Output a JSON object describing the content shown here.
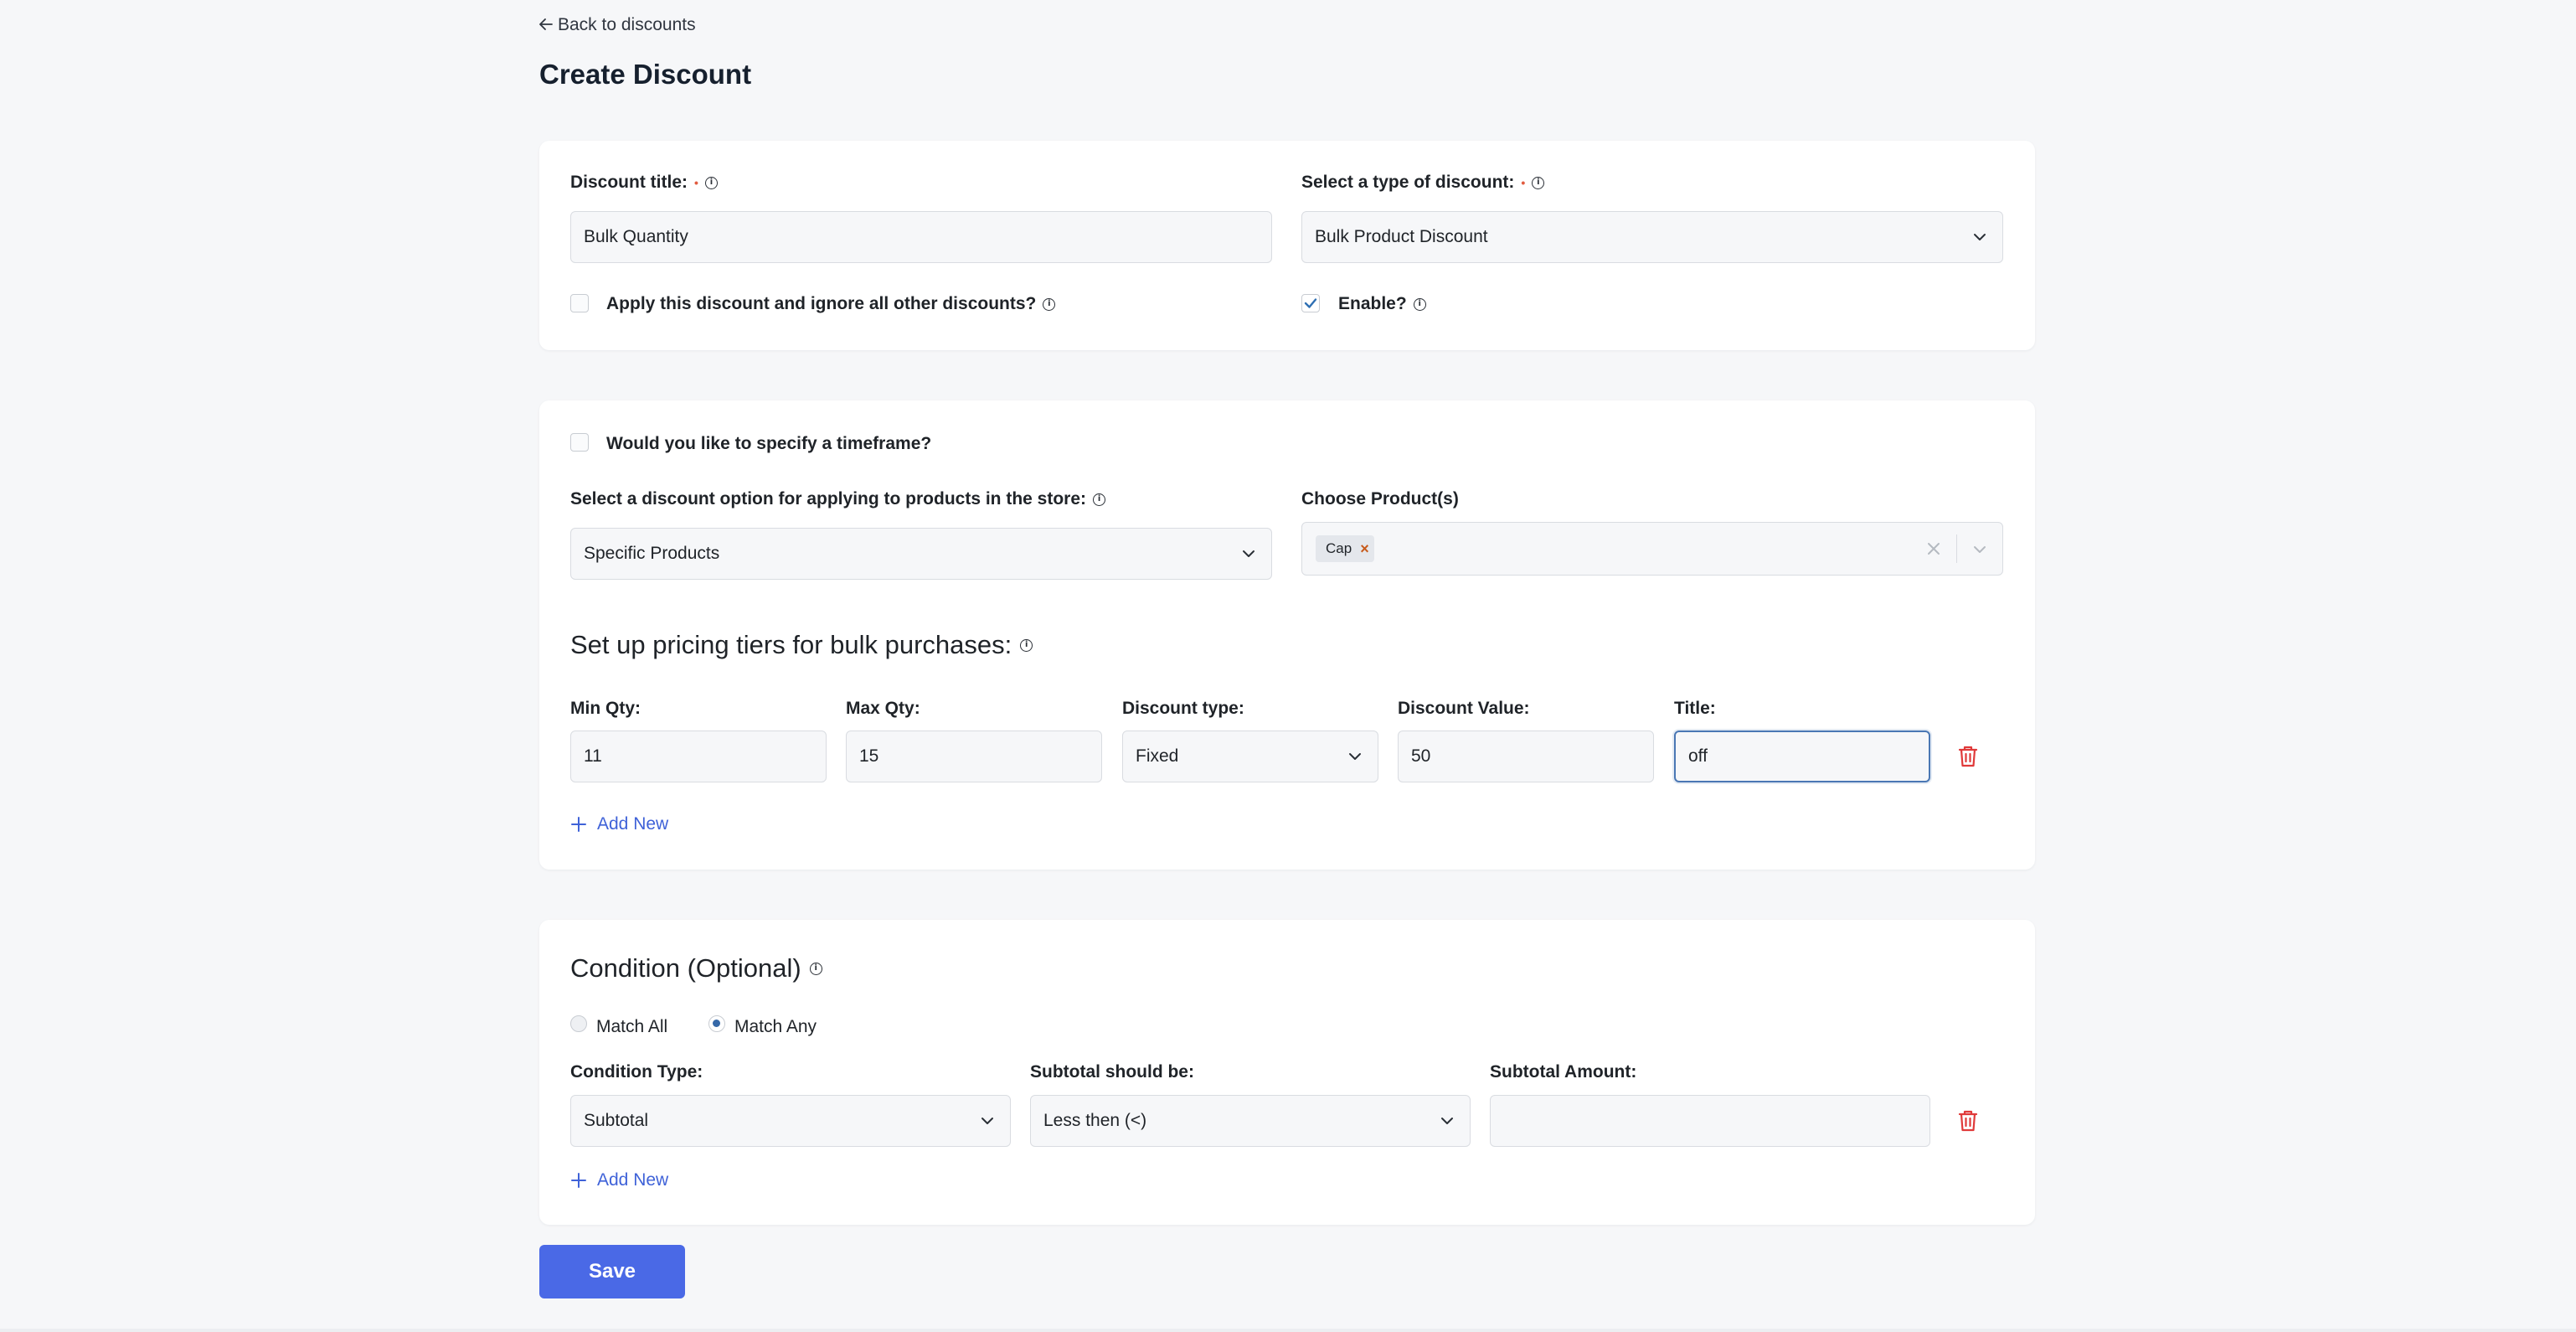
{
  "nav": {
    "back_label": "Back to discounts"
  },
  "page": {
    "title": "Create Discount"
  },
  "general": {
    "discount_title_label": "Discount title:",
    "discount_title_value": "Bulk Quantity",
    "type_label": "Select a type of discount:",
    "type_value": "Bulk Product Discount",
    "exclusive_label": "Apply this discount and ignore all other discounts?",
    "exclusive_checked": false,
    "enable_label": "Enable?",
    "enable_checked": true
  },
  "products": {
    "timeframe_label": "Would you like to specify a timeframe?",
    "timeframe_checked": false,
    "option_label": "Select a discount option for applying to products in the store:",
    "option_value": "Specific Products",
    "choose_label": "Choose Product(s)",
    "chosen_tags": [
      "Cap"
    ]
  },
  "tiers": {
    "title": "Set up pricing tiers for bulk purchases:",
    "headers": {
      "min": "Min Qty:",
      "max": "Max Qty:",
      "type": "Discount type:",
      "value": "Discount Value:",
      "title": "Title:"
    },
    "rows": [
      {
        "min": "11",
        "max": "15",
        "type": "Fixed",
        "value": "50",
        "title": "off"
      }
    ],
    "add_label": "Add New"
  },
  "conditions": {
    "title": "Condition (Optional)",
    "match_all_label": "Match All",
    "match_any_label": "Match Any",
    "selected_match": "Match Any",
    "headers": {
      "type": "Condition Type:",
      "operator": "Subtotal should be:",
      "amount": "Subtotal Amount:"
    },
    "rows": [
      {
        "type": "Subtotal",
        "operator": "Less then (<)",
        "amount": ""
      }
    ],
    "add_label": "Add New"
  },
  "save_label": "Save",
  "colors": {
    "accent": "#4a69e6",
    "link": "#3f62d8",
    "danger": "#e03a3a",
    "required": "#e15b3f"
  }
}
